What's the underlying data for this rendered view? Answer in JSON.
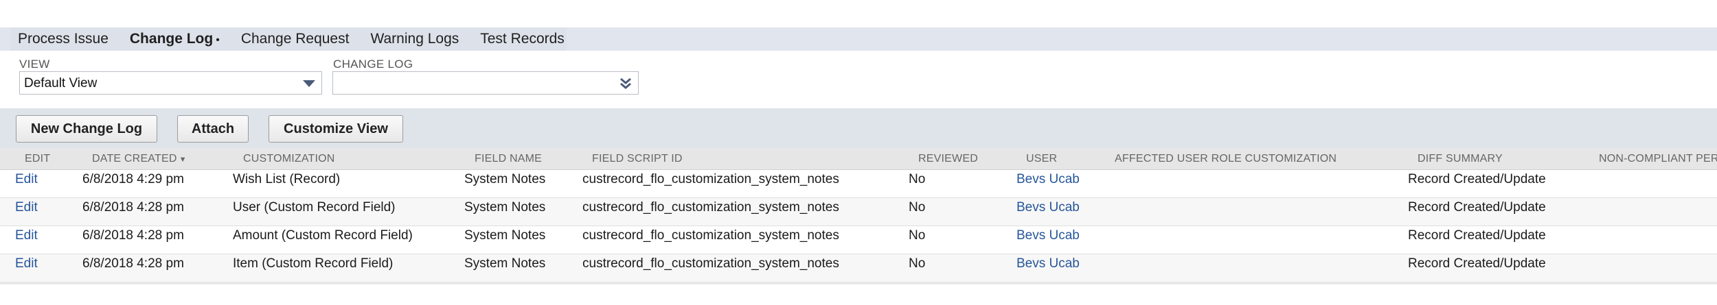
{
  "tabs": [
    {
      "label": "Process Issue",
      "active": false
    },
    {
      "label": "Change Log",
      "active": true,
      "marker": "•"
    },
    {
      "label": "Change Request",
      "active": false
    },
    {
      "label": "Warning Logs",
      "active": false
    },
    {
      "label": "Test Records",
      "active": false
    }
  ],
  "filters": {
    "view_label": "VIEW",
    "view_value": "Default View",
    "changelog_label": "CHANGE LOG",
    "changelog_value": ""
  },
  "toolbar": {
    "new_label": "New Change Log",
    "attach_label": "Attach",
    "customize_label": "Customize View"
  },
  "columns": [
    "EDIT",
    "DATE CREATED",
    "CUSTOMIZATION",
    "FIELD NAME",
    "FIELD SCRIPT ID",
    "REVIEWED",
    "USER",
    "AFFECTED USER ROLE CUSTOMIZATION",
    "DIFF SUMMARY",
    "NON-COMPLIANT PER"
  ],
  "sort_indicator": "▼",
  "rows": [
    {
      "edit": "Edit",
      "date": "6/8/2018 4:29 pm",
      "customization": "Wish List (Record)",
      "field_name": "System Notes",
      "script_id": "custrecord_flo_customization_system_notes",
      "reviewed": "No",
      "user": "Bevs Ucab",
      "affected": "",
      "diff": "Record Created/Update",
      "noncompliant": ""
    },
    {
      "edit": "Edit",
      "date": "6/8/2018 4:28 pm",
      "customization": "User (Custom Record Field)",
      "field_name": "System Notes",
      "script_id": "custrecord_flo_customization_system_notes",
      "reviewed": "No",
      "user": "Bevs Ucab",
      "affected": "",
      "diff": "Record Created/Update",
      "noncompliant": ""
    },
    {
      "edit": "Edit",
      "date": "6/8/2018 4:28 pm",
      "customization": "Amount (Custom Record Field)",
      "field_name": "System Notes",
      "script_id": "custrecord_flo_customization_system_notes",
      "reviewed": "No",
      "user": "Bevs Ucab",
      "affected": "",
      "diff": "Record Created/Update",
      "noncompliant": ""
    },
    {
      "edit": "Edit",
      "date": "6/8/2018 4:28 pm",
      "customization": "Item (Custom Record Field)",
      "field_name": "System Notes",
      "script_id": "custrecord_flo_customization_system_notes",
      "reviewed": "No",
      "user": "Bevs Ucab",
      "affected": "",
      "diff": "Record Created/Update",
      "noncompliant": ""
    }
  ],
  "colors": {
    "link": "#255599",
    "tab_bar": "#dde2ea",
    "toolbar": "#dfe3ea",
    "header": "#e6e6e6"
  }
}
